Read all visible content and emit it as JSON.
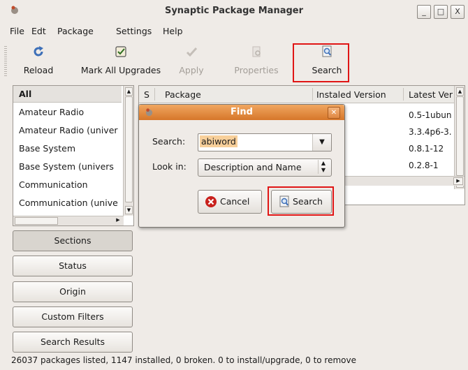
{
  "window": {
    "title": "Synaptic Package Manager",
    "controls": [
      "_",
      "□",
      "X"
    ]
  },
  "menu": [
    "File",
    "Edt",
    "Package",
    "Settings",
    "Help"
  ],
  "toolbar": {
    "reload": "Reload",
    "mark_all": "Mark All Upgrades",
    "apply": "Apply",
    "properties": "Properties",
    "search": "Search"
  },
  "sections_panel": {
    "header": "All",
    "items": [
      "Amateur Radio",
      "Amateur Radio (univer",
      "Base System",
      "Base System (univers",
      "Communication",
      "Communication (unive"
    ]
  },
  "filter_buttons": {
    "sections": "Sections",
    "status": "Status",
    "origin": "Origin",
    "custom": "Custom Filters",
    "search_results": "Search Results"
  },
  "package_list": {
    "columns": [
      "S",
      "Package",
      "Instaled Version",
      "Latest Ver"
    ],
    "latest_versions": [
      "0.5-1ubun",
      "3.3.4p6-3.",
      "0.8.1-12",
      "0.2.8-1"
    ]
  },
  "find_dialog": {
    "title": "Find",
    "search_label": "Search:",
    "search_value": "abiword",
    "look_in_label": "Look in:",
    "look_in_value": "Description and Name",
    "cancel": "Cancel",
    "search_button": "Search"
  },
  "status_bar": "26037 packages listed, 1147 installed, 0 broken. 0 to install/upgrade, 0 to remove",
  "colors": {
    "highlight": "#e01515",
    "dialog_title": "#d6772a",
    "window_bg": "#efebe7"
  }
}
